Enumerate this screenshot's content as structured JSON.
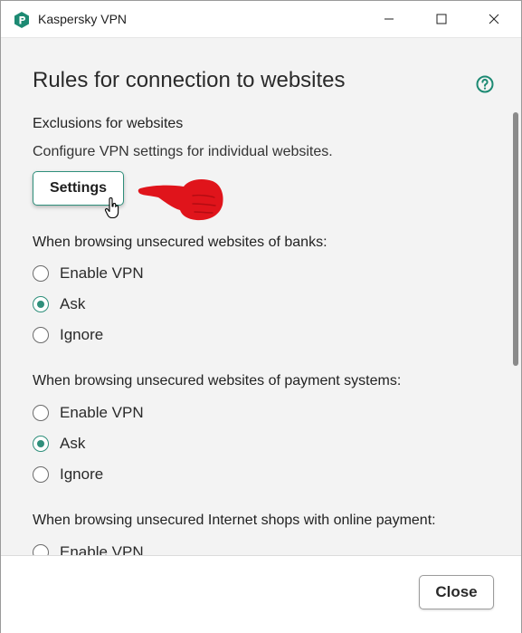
{
  "window": {
    "title": "Kaspersky VPN",
    "accent_color": "#2f8f7b"
  },
  "page": {
    "title": "Rules for connection to websites",
    "help_icon": "help-circle-icon"
  },
  "exclusions": {
    "heading": "Exclusions for websites",
    "description": "Configure VPN settings for individual websites.",
    "settings_label": "Settings"
  },
  "groups": [
    {
      "heading": "When browsing unsecured websites of banks:",
      "options": [
        "Enable VPN",
        "Ask",
        "Ignore"
      ],
      "selected": "Ask"
    },
    {
      "heading": "When browsing unsecured websites of payment systems:",
      "options": [
        "Enable VPN",
        "Ask",
        "Ignore"
      ],
      "selected": "Ask"
    },
    {
      "heading": "When browsing unsecured Internet shops with online payment:",
      "options": [
        "Enable VPN"
      ],
      "selected": ""
    }
  ],
  "footer": {
    "close_label": "Close"
  }
}
